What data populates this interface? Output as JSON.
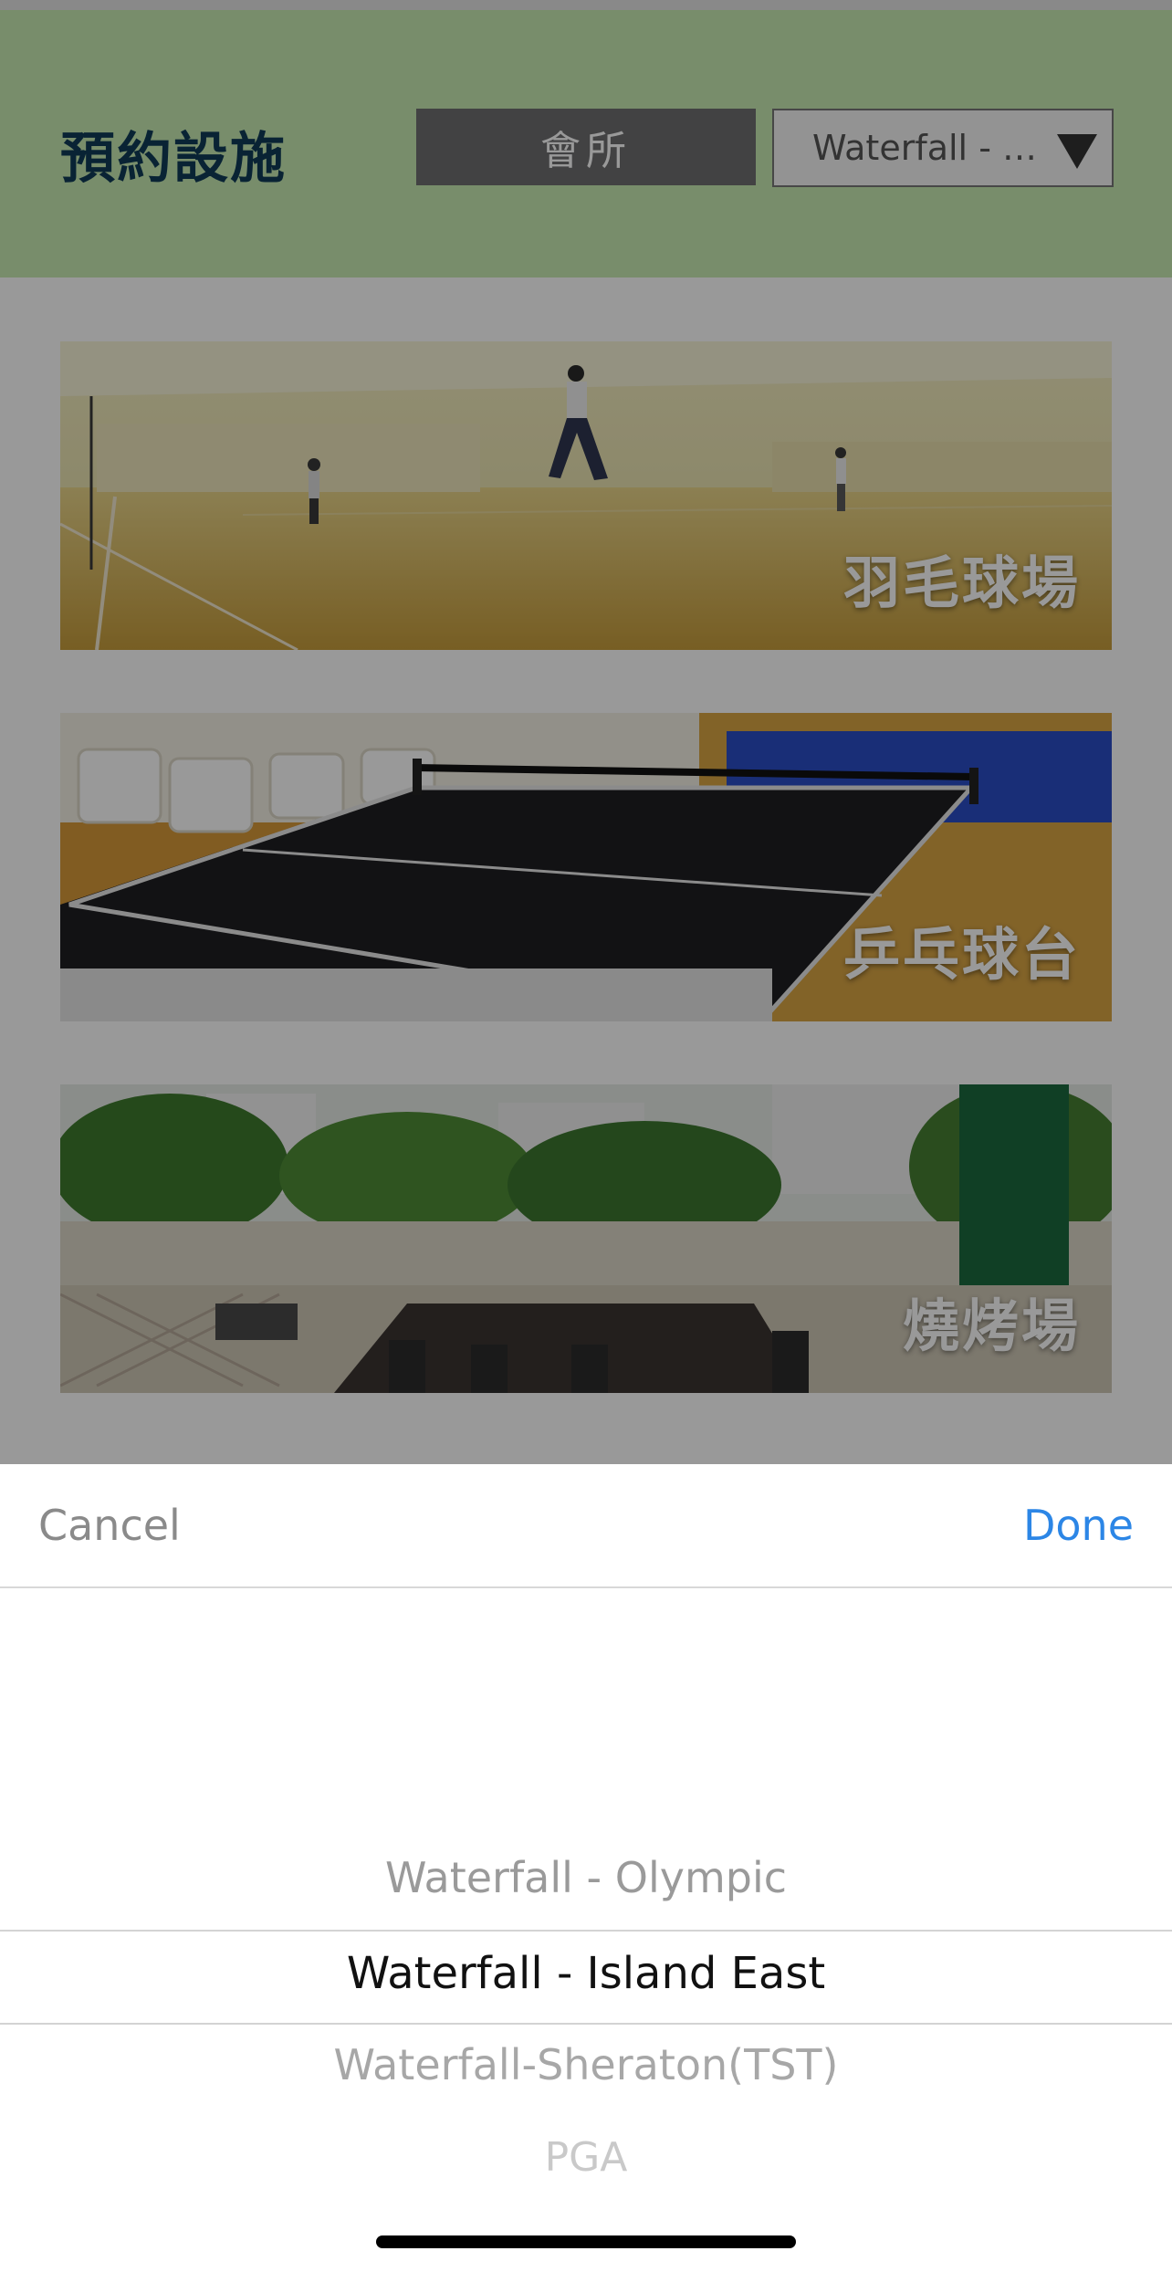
{
  "header": {
    "title": "預約設施",
    "club_button": "會所",
    "location_value": "Waterfall - I..."
  },
  "facilities": [
    {
      "label": "羽毛球場",
      "image": "badminton-court-photo"
    },
    {
      "label": "乒乓球台",
      "image": "table-tennis-photo"
    },
    {
      "label": "燒烤場",
      "image": "bbq-area-photo"
    }
  ],
  "picker": {
    "cancel_label": "Cancel",
    "done_label": "Done",
    "options": [
      "Waterfall - Olympic",
      "Waterfall - Island East",
      "Waterfall-Sheraton(TST)",
      "PGA"
    ],
    "selected_index": 1
  },
  "colors": {
    "header_bg": "#c8ebb3",
    "title": "#0f3b57",
    "accent": "#2c86e6"
  },
  "icons": {
    "dropdown": "triangle-down-icon"
  }
}
